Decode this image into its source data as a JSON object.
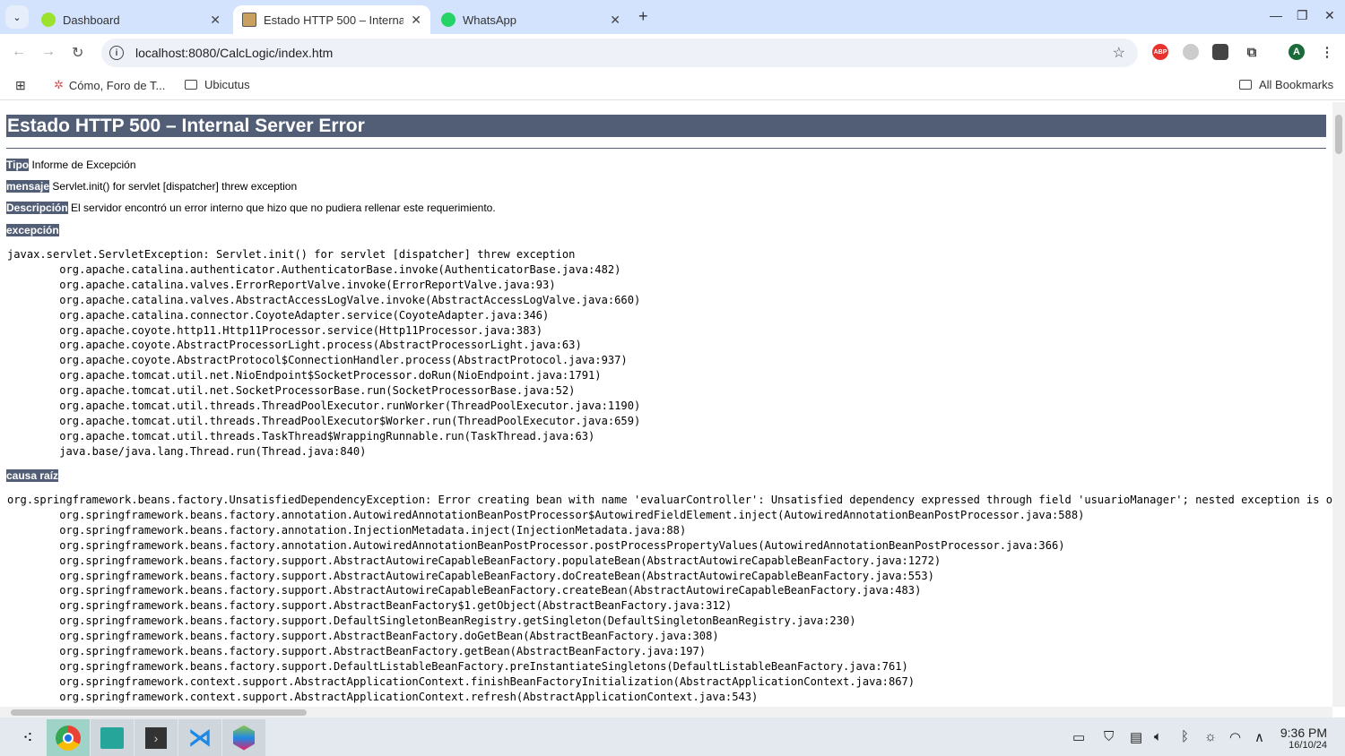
{
  "browser": {
    "tabs": [
      {
        "label": "Dashboard",
        "icon": "dashboard-favicon",
        "active": false
      },
      {
        "label": "Estado HTTP 500 – Internal Server Error",
        "icon": "tomcat-favicon",
        "active": true
      },
      {
        "label": "WhatsApp",
        "icon": "whatsapp-icon",
        "active": false
      }
    ],
    "url": "localhost:8080/CalcLogic/index.htm",
    "bookmarks": [
      {
        "label": "Cómo, Foro de T..."
      },
      {
        "label": "Ubicutus"
      }
    ],
    "all_bookmarks": "All Bookmarks",
    "profile_initial": "A",
    "adblock_label": "ABP"
  },
  "page": {
    "title": "Estado HTTP 500 – Internal Server Error",
    "tipo_label": "Tipo",
    "tipo": "Informe de Excepción",
    "mensaje_label": "mensaje",
    "mensaje": "Servlet.init() for servlet [dispatcher] threw exception",
    "descripcion_label": "Descripción",
    "descripcion": "El servidor encontró un error interno que hizo que no pudiera rellenar este requerimiento.",
    "excepcion_label": "excepción",
    "exception_trace": "javax.servlet.ServletException: Servlet.init() for servlet [dispatcher] threw exception\n\torg.apache.catalina.authenticator.AuthenticatorBase.invoke(AuthenticatorBase.java:482)\n\torg.apache.catalina.valves.ErrorReportValve.invoke(ErrorReportValve.java:93)\n\torg.apache.catalina.valves.AbstractAccessLogValve.invoke(AbstractAccessLogValve.java:660)\n\torg.apache.catalina.connector.CoyoteAdapter.service(CoyoteAdapter.java:346)\n\torg.apache.coyote.http11.Http11Processor.service(Http11Processor.java:383)\n\torg.apache.coyote.AbstractProcessorLight.process(AbstractProcessorLight.java:63)\n\torg.apache.coyote.AbstractProtocol$ConnectionHandler.process(AbstractProtocol.java:937)\n\torg.apache.tomcat.util.net.NioEndpoint$SocketProcessor.doRun(NioEndpoint.java:1791)\n\torg.apache.tomcat.util.net.SocketProcessorBase.run(SocketProcessorBase.java:52)\n\torg.apache.tomcat.util.threads.ThreadPoolExecutor.runWorker(ThreadPoolExecutor.java:1190)\n\torg.apache.tomcat.util.threads.ThreadPoolExecutor$Worker.run(ThreadPoolExecutor.java:659)\n\torg.apache.tomcat.util.threads.TaskThread$WrappingRunnable.run(TaskThread.java:63)\n\tjava.base/java.lang.Thread.run(Thread.java:840)",
    "causa_label": "causa raíz",
    "cause_trace": "org.springframework.beans.factory.UnsatisfiedDependencyException: Error creating bean with name 'evaluarController': Unsatisfied dependency expressed through field 'usuarioManager'; nested exception is o\n\torg.springframework.beans.factory.annotation.AutowiredAnnotationBeanPostProcessor$AutowiredFieldElement.inject(AutowiredAnnotationBeanPostProcessor.java:588)\n\torg.springframework.beans.factory.annotation.InjectionMetadata.inject(InjectionMetadata.java:88)\n\torg.springframework.beans.factory.annotation.AutowiredAnnotationBeanPostProcessor.postProcessPropertyValues(AutowiredAnnotationBeanPostProcessor.java:366)\n\torg.springframework.beans.factory.support.AbstractAutowireCapableBeanFactory.populateBean(AbstractAutowireCapableBeanFactory.java:1272)\n\torg.springframework.beans.factory.support.AbstractAutowireCapableBeanFactory.doCreateBean(AbstractAutowireCapableBeanFactory.java:553)\n\torg.springframework.beans.factory.support.AbstractAutowireCapableBeanFactory.createBean(AbstractAutowireCapableBeanFactory.java:483)\n\torg.springframework.beans.factory.support.AbstractBeanFactory$1.getObject(AbstractBeanFactory.java:312)\n\torg.springframework.beans.factory.support.DefaultSingletonBeanRegistry.getSingleton(DefaultSingletonBeanRegistry.java:230)\n\torg.springframework.beans.factory.support.AbstractBeanFactory.doGetBean(AbstractBeanFactory.java:308)\n\torg.springframework.beans.factory.support.AbstractBeanFactory.getBean(AbstractBeanFactory.java:197)\n\torg.springframework.beans.factory.support.DefaultListableBeanFactory.preInstantiateSingletons(DefaultListableBeanFactory.java:761)\n\torg.springframework.context.support.AbstractApplicationContext.finishBeanFactoryInitialization(AbstractApplicationContext.java:867)\n\torg.springframework.context.support.AbstractApplicationContext.refresh(AbstractApplicationContext.java:543)"
  },
  "taskbar": {
    "apps": [
      "launcher-icon",
      "chrome-icon",
      "files-icon",
      "terminal-icon",
      "vscode-icon",
      "netbeans-icon"
    ],
    "time": "9:36 PM",
    "date": "16/10/24"
  },
  "colors": {
    "header": "#525d76",
    "tabbar": "#d3e3fd"
  }
}
